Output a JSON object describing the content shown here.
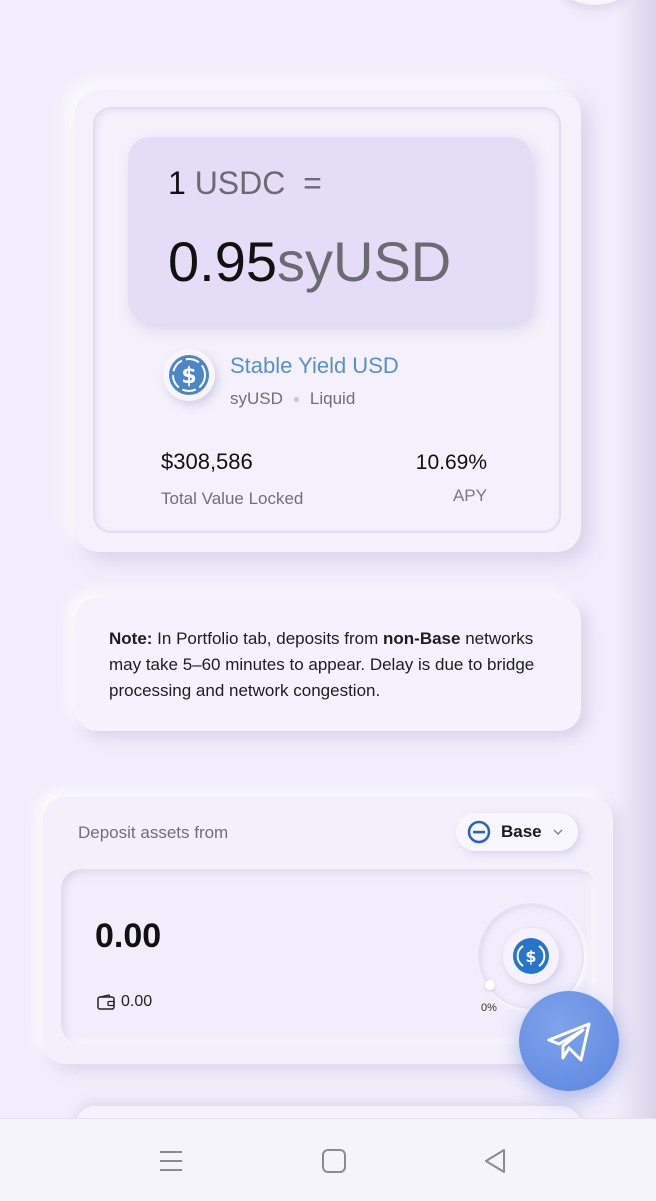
{
  "rate": {
    "input_amount": "1",
    "input_token": "USDC",
    "equals": "=",
    "output_amount": "0.95",
    "output_token": "syUSD"
  },
  "token": {
    "name": "Stable Yield USD",
    "symbol": "syUSD",
    "type": "Liquid",
    "icon": "dollar-coin-icon"
  },
  "stats": {
    "tvl_value": "$308,586",
    "tvl_label": "Total Value Locked",
    "apy_value": "10.69%",
    "apy_label": "APY"
  },
  "note": {
    "label": "Note:",
    "text_1": " In Portfolio tab, deposits from ",
    "bold": "non-Base",
    "text_2": " networks may take 5–60 minutes to appear. Delay is due to bridge processing and network congestion."
  },
  "deposit": {
    "label": "Deposit assets from",
    "network": "Base",
    "amount": "0.00",
    "balance": "0.00",
    "percent": "0%",
    "percent_value": 0
  },
  "colors": {
    "accent_blue": "#5b84de",
    "link_blue": "#5a8fc6",
    "background": "#f1edfb",
    "rate_box": "#e5ddf7"
  },
  "navbar": {
    "icons": [
      "menu-icon",
      "home-square-icon",
      "back-triangle-icon"
    ]
  }
}
